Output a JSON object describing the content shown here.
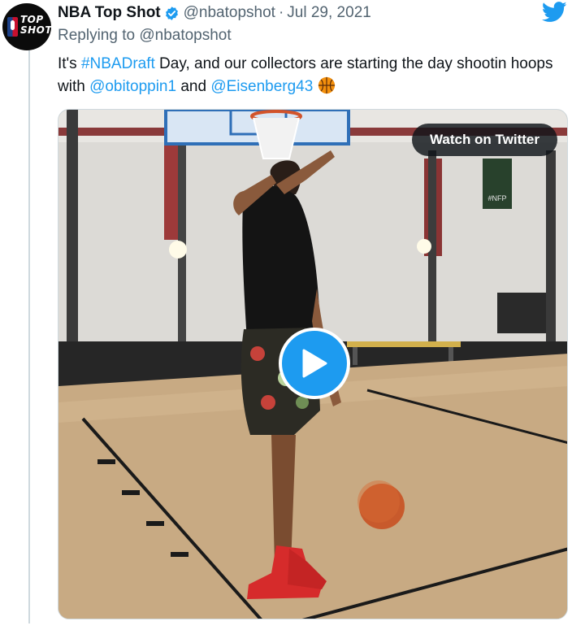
{
  "tweet": {
    "display_name": "NBA Top Shot",
    "handle": "@nbatopshot",
    "separator": "·",
    "date": "Jul 29, 2021",
    "avatar_text_line1": "TOP",
    "avatar_text_line2": "SHOT",
    "reply_prefix": "Replying to",
    "reply_to": "@nbatopshot",
    "text_part1": "It's ",
    "hashtag": "#NBADraft",
    "text_part2": " Day, and our collectors are starting the day shootin hoops with ",
    "mention1": "@obitoppin1",
    "text_part3": " and ",
    "mention2": "@Eisenberg43"
  },
  "media": {
    "watch_label": "Watch on Twitter",
    "banner_text": "#NFP"
  },
  "colors": {
    "twitter_blue": "#1d9bf0",
    "text": "#0f1419",
    "secondary": "#536471",
    "floor": "#c9ac85",
    "wall": "#dedcd8"
  },
  "icons": {
    "verified": "verified-badge-icon",
    "logo": "twitter-bird-icon",
    "emoji": "basketball-emoji",
    "play": "play-icon"
  }
}
